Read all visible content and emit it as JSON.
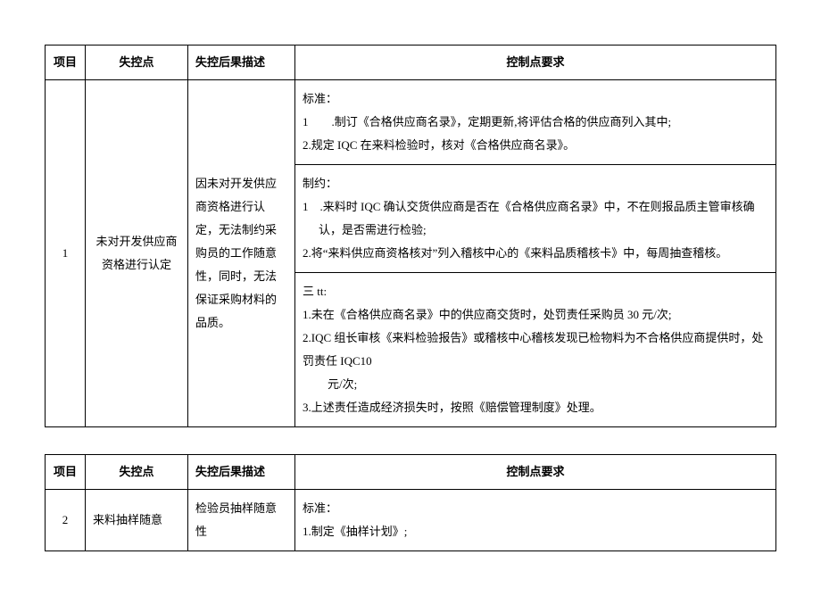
{
  "headers": {
    "item": "项目",
    "point": "失控点",
    "desc": "失控后果描述",
    "req": "控制点要求"
  },
  "table1": {
    "item_no": "1",
    "point": "未对开发供应商资格进行认定",
    "desc": "因未对开发供应商资格进行认定，无法制约采购员的工作随意性，同时，无法保证采购材料的品质。",
    "section1": {
      "title": "标准：",
      "line1": "1　　.制订《合格供应商名录》，定期更新,将评估合格的供应商列入其中;",
      "line2": "2.规定 IQC 在来料检验时，核对《合格供应商名录》。"
    },
    "section2": {
      "title": "制约：",
      "line1": "1　.来料时 IQC 确认交货供应商是否在《合格供应商名录》中，不在则报品质主管审核确认，是否需进行检验;",
      "line2": "2.将“来料供应商资格核对”列入稽核中心的《来料品质稽核卡》中，每周抽查稽核。"
    },
    "section3": {
      "title": "三 tt:",
      "line1": "1.未在《合格供应商名录》中的供应商交货时，处罚责任采购员 30 元/次;",
      "line2": "2.IQC 组长审核《来料检验报告》或稽核中心稽核发现已检物料为不合格供应商提供时，处罚责任 IQC10",
      "line2b": "元/次;",
      "line3": "3.上述责任造成经济损失时，按照《赔偿管理制度》处理。"
    }
  },
  "table2": {
    "item_no": "2",
    "point": "来料抽样随意",
    "desc": "检验员抽样随意性",
    "section1": {
      "title": "标准：",
      "line1": "1.制定《抽样计划》;"
    }
  }
}
